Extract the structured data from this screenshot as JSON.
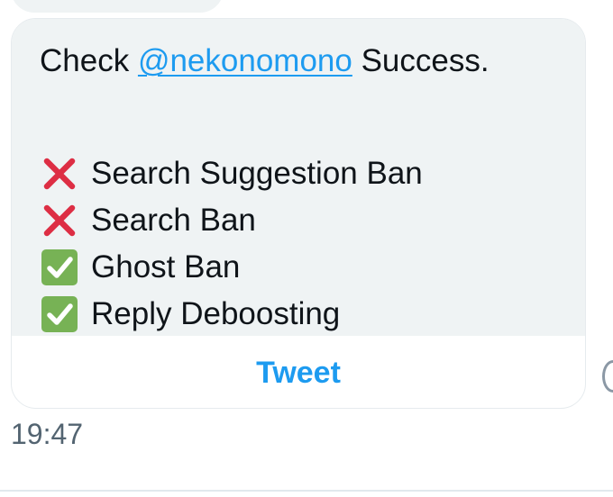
{
  "message": {
    "prefix": "Check ",
    "mention": "@nekonomono",
    "suffix": " Success."
  },
  "status_items": [
    {
      "label": "Search Suggestion Ban",
      "icon": "cross-mark-icon",
      "color": "#dd2e44"
    },
    {
      "label": "Search Ban",
      "icon": "cross-mark-icon",
      "color": "#dd2e44"
    },
    {
      "label": "Ghost Ban",
      "icon": "check-mark-button-icon",
      "color": "#77b255"
    },
    {
      "label": "Reply Deboosting",
      "icon": "check-mark-button-icon",
      "color": "#77b255"
    }
  ],
  "actions": {
    "tweet_label": "Tweet"
  },
  "timestamp": "19:47",
  "colors": {
    "bubble_bg": "#eff3f4",
    "link": "#1d9bf0",
    "text": "#0f1419",
    "muted": "#536471"
  }
}
